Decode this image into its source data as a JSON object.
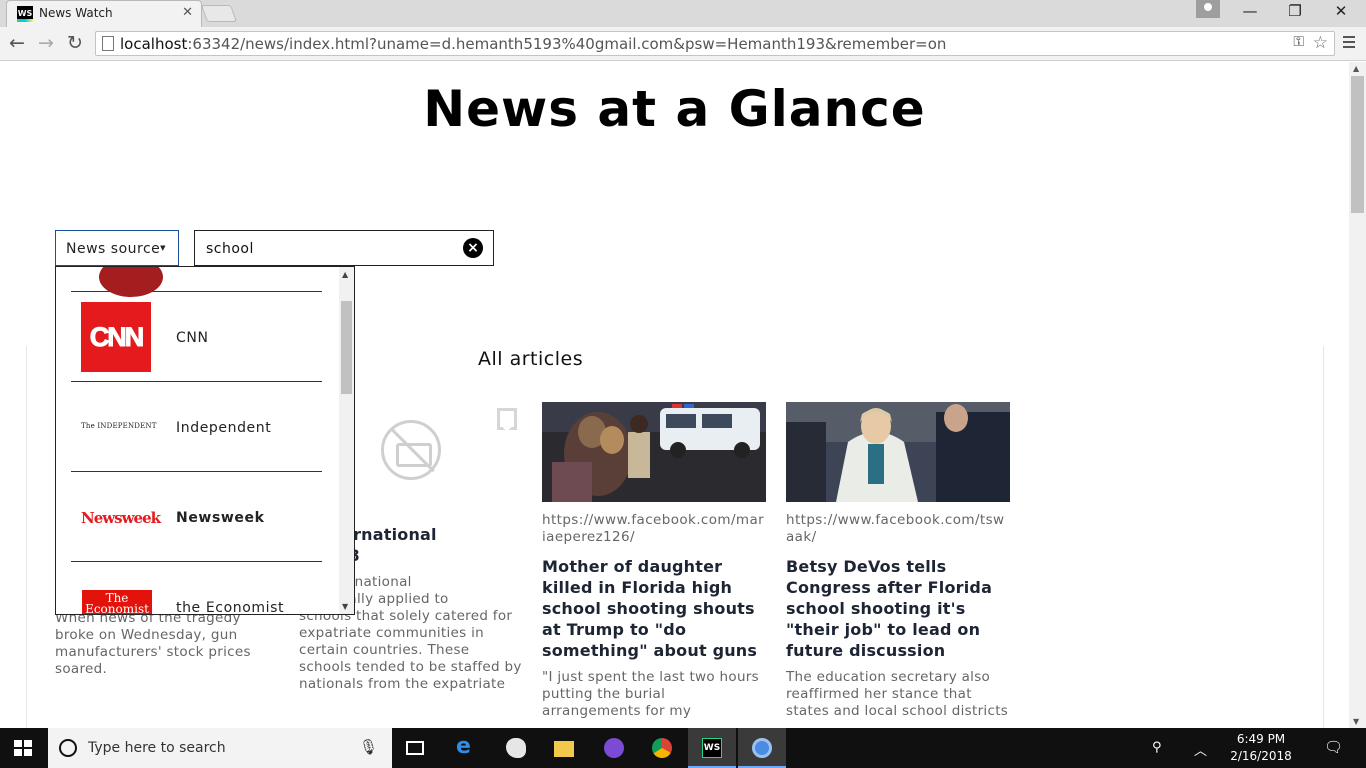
{
  "browser": {
    "tab_title": "News Watch",
    "tab_icon": "webstorm-icon",
    "url_host": "localhost",
    "url_rest": ":63342/news/index.html?uname=d.hemanth5193%40gmail.com&psw=Hemanth193&remember=on"
  },
  "page": {
    "title": "News at a Glance",
    "source_button_label": "News source",
    "search_value": "school",
    "section_title": "All articles"
  },
  "sources": [
    {
      "label": "",
      "logo": "partial-red-logo"
    },
    {
      "label": "CNN",
      "logo": "CNN"
    },
    {
      "label": "Independent",
      "logo": "The INDEPENDENT"
    },
    {
      "label": "Newsweek",
      "logo": "Newsweek"
    },
    {
      "label": "the Economist",
      "logo_line1": "The",
      "logo_line2": "Economist"
    }
  ],
  "articles": [
    {
      "title": "",
      "description": "When news of the tragedy broke on Wednesday, gun manufacturers' stock prices soared."
    },
    {
      "title_visible": "g International\ns 2018",
      "description_visible": "m ‘International\n’ originally applied to\nschools that solely catered for expatriate communities in certain countries. These schools tended to be staffed by nationals from the expatriate"
    },
    {
      "url": "https://www.facebook.com/mariaeperez126/",
      "title": "Mother of daughter killed in Florida high school shooting shouts at Trump to \"do something\" about guns",
      "description": "\"I just spent the last two hours putting the burial arrangements for my"
    },
    {
      "url": "https://www.facebook.com/tswaak/",
      "title": "Betsy DeVos tells Congress after Florida school shooting it's \"their job\" to lead on future discussion",
      "description": "The education secretary also reaffirmed her stance that states and local school districts"
    }
  ],
  "taskbar": {
    "search_placeholder": "Type here to search",
    "time": "6:49 PM",
    "date": "2/16/2018"
  }
}
